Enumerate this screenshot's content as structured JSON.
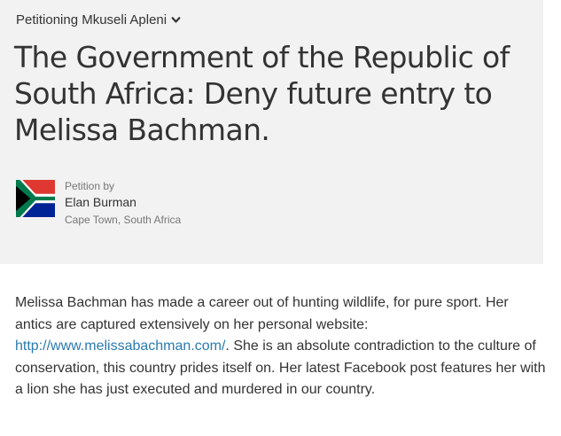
{
  "petition": {
    "petitioning_label": "Petitioning Mkuseli Apleni",
    "title": "The Government of the Republic of South Africa: Deny future entry to Melissa Bachman.",
    "author": {
      "by_label": "Petition by",
      "name": "Elan Burman",
      "location": "Cape Town, South Africa",
      "flag_icon": "south-africa-flag-icon"
    },
    "body": {
      "text_before_link": "Melissa Bachman has made a career out of hunting wildlife, for pure sport. Her antics are captured extensively on her personal website: ",
      "link_text": "http://www.melissabachman.com/",
      "text_after_link": ". She is an absolute contradiction to the culture of conservation, this country prides itself on. Her latest Facebook post features her with a lion she has just executed and murdered in our country."
    }
  },
  "colors": {
    "header_background": "#f2f2f2",
    "text": "#333333",
    "muted_text": "#777777",
    "link": "#2a7ab0"
  }
}
